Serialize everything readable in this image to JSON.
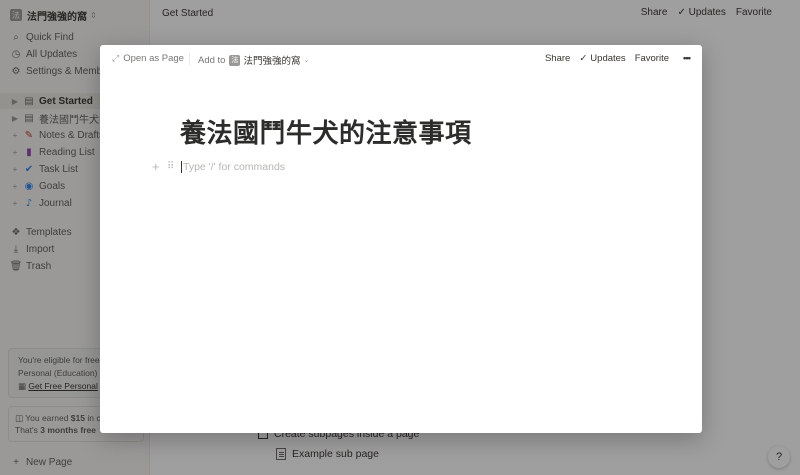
{
  "workspace": {
    "name": "法門強強的窩",
    "logo_char": "法"
  },
  "sidebar": {
    "top_items": [
      {
        "label": "Quick Find",
        "icon": "search-icon"
      },
      {
        "label": "All Updates",
        "icon": "clock-icon"
      },
      {
        "label": "Settings & Members",
        "icon": "gear-icon"
      }
    ],
    "pages": [
      {
        "label": "Get Started",
        "icon": "document-icon",
        "active": true
      },
      {
        "label": "養法國鬥牛犬的注意事項",
        "icon": "document-icon"
      },
      {
        "label": "Notes & Drafts",
        "icon": "pencil-emoji-icon"
      },
      {
        "label": "Reading List",
        "icon": "books-emoji-icon"
      },
      {
        "label": "Task List",
        "icon": "check-emoji-icon"
      },
      {
        "label": "Goals",
        "icon": "target-emoji-icon"
      },
      {
        "label": "Journal",
        "icon": "microphone-emoji-icon"
      }
    ],
    "bottom_items": [
      {
        "label": "Templates",
        "icon": "templates-icon"
      },
      {
        "label": "Import",
        "icon": "import-icon"
      },
      {
        "label": "Trash",
        "icon": "trash-icon"
      }
    ],
    "promo": {
      "line1": "You're eligible for free",
      "line2": "Personal (Education) P",
      "link": "Get Free Personal"
    },
    "credit": {
      "prefix": "You earned ",
      "amount": "$15",
      "suffix": " in cr",
      "line2_prefix": "That's ",
      "line2_bold": "3 months free"
    },
    "new_page": "New Page"
  },
  "topbar": {
    "breadcrumb": "Get Started",
    "share": "Share",
    "updates": "Updates",
    "favorite": "Favorite"
  },
  "background_content": {
    "todo_text": "Create subpages inside a page",
    "subpage_text": "Example sub page"
  },
  "help": {
    "label": "?"
  },
  "modal": {
    "open_as_page": "Open as Page",
    "add_to": "Add to",
    "workspace_name": "法門強強的窩",
    "share": "Share",
    "updates": "Updates",
    "favorite": "Favorite",
    "title": "養法國鬥牛犬的注意事項",
    "placeholder": "Type '/' for commands"
  }
}
